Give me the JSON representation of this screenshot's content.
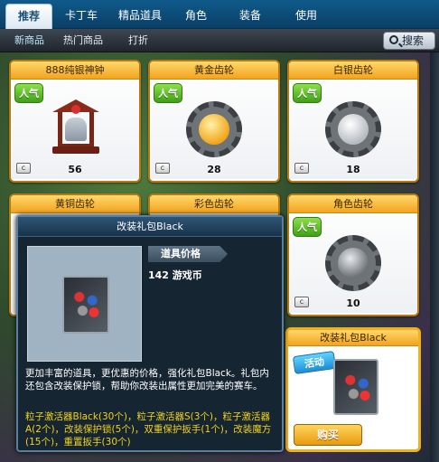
{
  "tabs": [
    {
      "label": "推荐",
      "active": true
    },
    {
      "label": "卡丁车",
      "active": false
    },
    {
      "label": "精品道具",
      "active": false
    },
    {
      "label": "角色",
      "active": false
    },
    {
      "label": "装备",
      "active": false
    },
    {
      "label": "使用",
      "active": false
    }
  ],
  "subtabs": [
    {
      "label": "新商品",
      "active": true
    },
    {
      "label": "热门商品",
      "active": false
    },
    {
      "label": "打折",
      "active": false
    }
  ],
  "search": {
    "label": "搜索"
  },
  "badges": {
    "popular": "人气",
    "activity": "活动"
  },
  "cards": [
    {
      "title": "888纯银神钟",
      "qty": "56",
      "popular": true
    },
    {
      "title": "黄金齿轮",
      "qty": "28",
      "popular": true,
      "color": "#f2a51a"
    },
    {
      "title": "白银齿轮",
      "qty": "18",
      "popular": true,
      "color": "#c8ccd0"
    },
    {
      "title": "黄铜齿轮"
    },
    {
      "title": "彩色齿轮"
    },
    {
      "title": "角色齿轮",
      "qty": "10",
      "popular": true,
      "color": "#9aa0a6"
    }
  ],
  "popup": {
    "title": "改装礼包Black",
    "price_label": "道具价格",
    "price_value": "142 游戏币",
    "description": "更加丰富的道具，更优惠的价格，强化礼包Black。礼包内还包含改装保护锁，帮助你改装出属性更加完美的赛车。",
    "contents": "粒子激活器Black(30个)，粒子激活器S(3个)，粒子激活器A(2个)，改装保护锁(5个)，双重保护扳手(1个)，改装魔方(15个)，重置扳手(30个)"
  },
  "featured": {
    "title": "改装礼包Black",
    "buy_label": "购买"
  }
}
